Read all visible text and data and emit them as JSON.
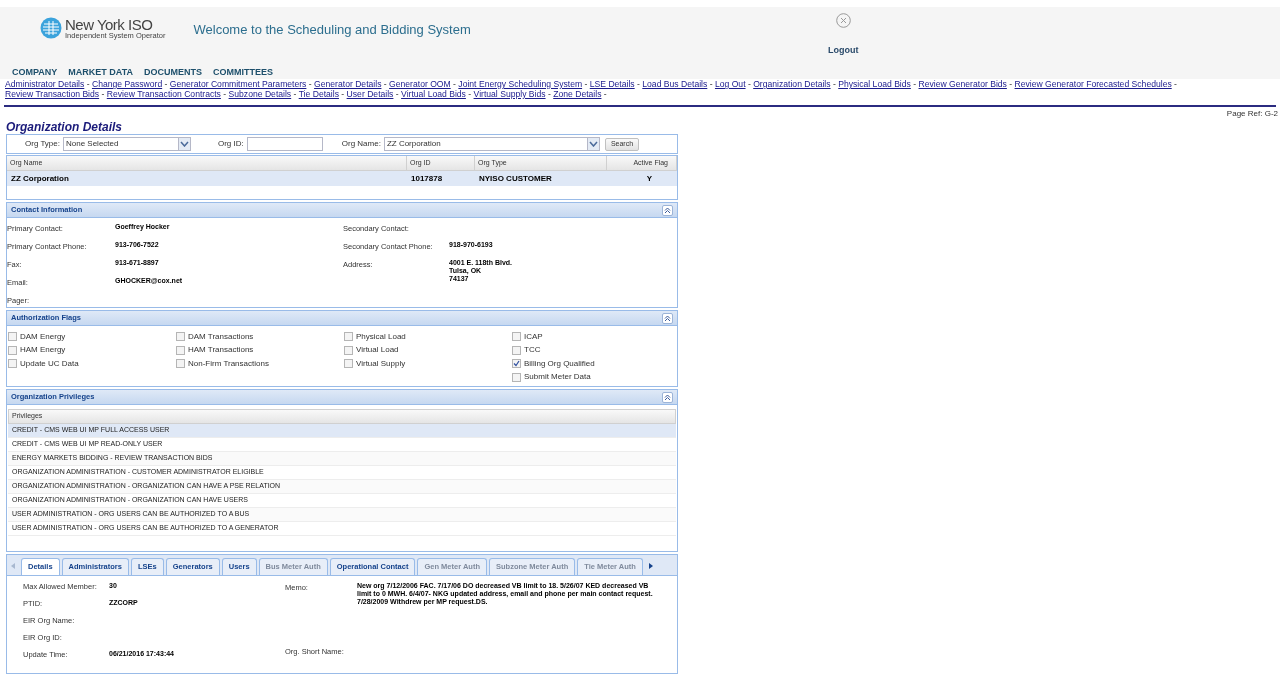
{
  "header": {
    "logo_name": "New York ISO",
    "logo_tagline": "Independent System Operator",
    "title": "Welcome to the Scheduling and Bidding System",
    "logout": "Logout"
  },
  "nav_menu": [
    "COMPANY",
    "MARKET DATA",
    "DOCUMENTS",
    "COMMITTEES"
  ],
  "links": [
    "Administrator Details",
    "Change Password",
    "Generator Commitment Parameters",
    "Generator Details",
    "Generator OOM",
    "Joint Energy Scheduling System",
    "LSE Details",
    "Load Bus Details",
    "Log Out",
    "Organization Details",
    "Physical Load Bids",
    "Review Generator Bids",
    "Review Generator Forecasted Schedules",
    "Review Transaction Bids",
    "Review Transaction Contracts",
    "Subzone Details",
    "Tie Details",
    "User Details",
    "Virtual Load Bids",
    "Virtual Supply Bids",
    "Zone Details"
  ],
  "link_separator": "-",
  "page_ref": "Page Ref: G-2",
  "page_title": "Organization Details",
  "filters": {
    "org_type_label": "Org Type:",
    "org_type_value": "None Selected",
    "org_id_label": "Org ID:",
    "org_name_label": "Org Name:",
    "org_name_value": "ZZ Corporation",
    "search_button": "Search"
  },
  "org_table": {
    "columns": [
      "Org Name",
      "Org ID",
      "Org Type",
      "Active Flag"
    ],
    "rows": [
      {
        "cells": [
          "ZZ Corporation",
          "1017878",
          "NYISO CUSTOMER",
          "Y"
        ],
        "selected": true
      }
    ]
  },
  "contact_information": {
    "title": "Contact Information",
    "left": [
      {
        "label": "Primary Contact:",
        "value": "Goeffrey Hocker"
      },
      {
        "label": "Primary Contact Phone:",
        "value": "913-706-7522"
      },
      {
        "label": "Fax:",
        "value": "913-671-8897"
      },
      {
        "label": "Email:",
        "value": "GHOCKER@cox.net"
      },
      {
        "label": "Pager:"
      }
    ],
    "right": [
      {
        "label": "Secondary Contact:"
      },
      {
        "label": "Secondary Contact Phone:",
        "value": "918-970-6193"
      },
      {
        "label": "Address:",
        "value": "4001 E. 118th Blvd.\nTulsa, OK\n74137"
      }
    ]
  },
  "authorization_flags": {
    "title": "Authorization Flags",
    "columns": [
      [
        {
          "label": "DAM Energy",
          "checked": false
        },
        {
          "label": "HAM Energy",
          "checked": false
        },
        {
          "label": "Update UC Data",
          "checked": false
        }
      ],
      [
        {
          "label": "DAM Transactions",
          "checked": false
        },
        {
          "label": "HAM Transactions",
          "checked": false
        },
        {
          "label": "Non-Firm Transactions",
          "checked": false
        }
      ],
      [
        {
          "label": "Physical Load",
          "checked": false
        },
        {
          "label": "Virtual Load",
          "checked": false
        },
        {
          "label": "Virtual Supply",
          "checked": false
        }
      ],
      [
        {
          "label": "ICAP",
          "checked": false
        },
        {
          "label": "TCC",
          "checked": false
        },
        {
          "label": "Billing Org Qualified",
          "checked": true
        },
        {
          "label": "Submit Meter Data",
          "checked": false
        }
      ]
    ]
  },
  "organization_privileges": {
    "title": "Organization Privileges",
    "column": "Privileges",
    "rows": [
      {
        "text": "CREDIT - CMS WEB UI MP FULL ACCESS USER",
        "selected": true
      },
      {
        "text": "CREDIT - CMS WEB UI MP READ-ONLY USER",
        "selected": false
      },
      {
        "text": "ENERGY MARKETS BIDDING - REVIEW TRANSACTION BIDS",
        "selected": false
      },
      {
        "text": "ORGANIZATION ADMINISTRATION - CUSTOMER ADMINISTRATOR ELIGIBLE",
        "selected": false
      },
      {
        "text": "ORGANIZATION ADMINISTRATION - ORGANIZATION CAN HAVE A PSE RELATION",
        "selected": false
      },
      {
        "text": "ORGANIZATION ADMINISTRATION - ORGANIZATION CAN HAVE USERS",
        "selected": false
      },
      {
        "text": "USER ADMINISTRATION - ORG USERS CAN BE AUTHORIZED TO A BUS",
        "selected": false
      },
      {
        "text": "USER ADMINISTRATION - ORG USERS CAN BE AUTHORIZED TO A GENERATOR",
        "selected": false
      }
    ]
  },
  "tabs": [
    {
      "label": "Details",
      "selected": true,
      "disabled": false
    },
    {
      "label": "Administrators",
      "selected": false,
      "disabled": false
    },
    {
      "label": "LSEs",
      "selected": false,
      "disabled": false
    },
    {
      "label": "Generators",
      "selected": false,
      "disabled": false
    },
    {
      "label": "Users",
      "selected": false,
      "disabled": false
    },
    {
      "label": "Bus Meter Auth",
      "selected": false,
      "disabled": true
    },
    {
      "label": "Operational Contact",
      "selected": false,
      "disabled": false
    },
    {
      "label": "Gen Meter Auth",
      "selected": false,
      "disabled": true
    },
    {
      "label": "Subzone Meter Auth",
      "selected": false,
      "disabled": true
    },
    {
      "label": "Tie Meter Auth",
      "selected": false,
      "disabled": true
    }
  ],
  "details": {
    "left": [
      {
        "label": "Max Allowed Member:",
        "value": "30"
      },
      {
        "label": "PTID:",
        "value": "ZZCORP"
      },
      {
        "label": "EIR Org Name:"
      },
      {
        "label": "EIR Org ID:"
      },
      {
        "label": "Update Time:",
        "value": "06/21/2016 17:43:44"
      }
    ],
    "right": [
      {
        "label": "Memo:",
        "value": "New org 7/12/2006 FAC. 7/17/06 DO decreased VB limit to 18.  5/26/07 KED decreased VB limit to 0 MWH. 6/4/07- NKG updated address, email and phone per main contact request. 7/28/2009 Withdrew  per MP request.DS."
      },
      {
        "label": "Org. Short Name:"
      }
    ]
  }
}
